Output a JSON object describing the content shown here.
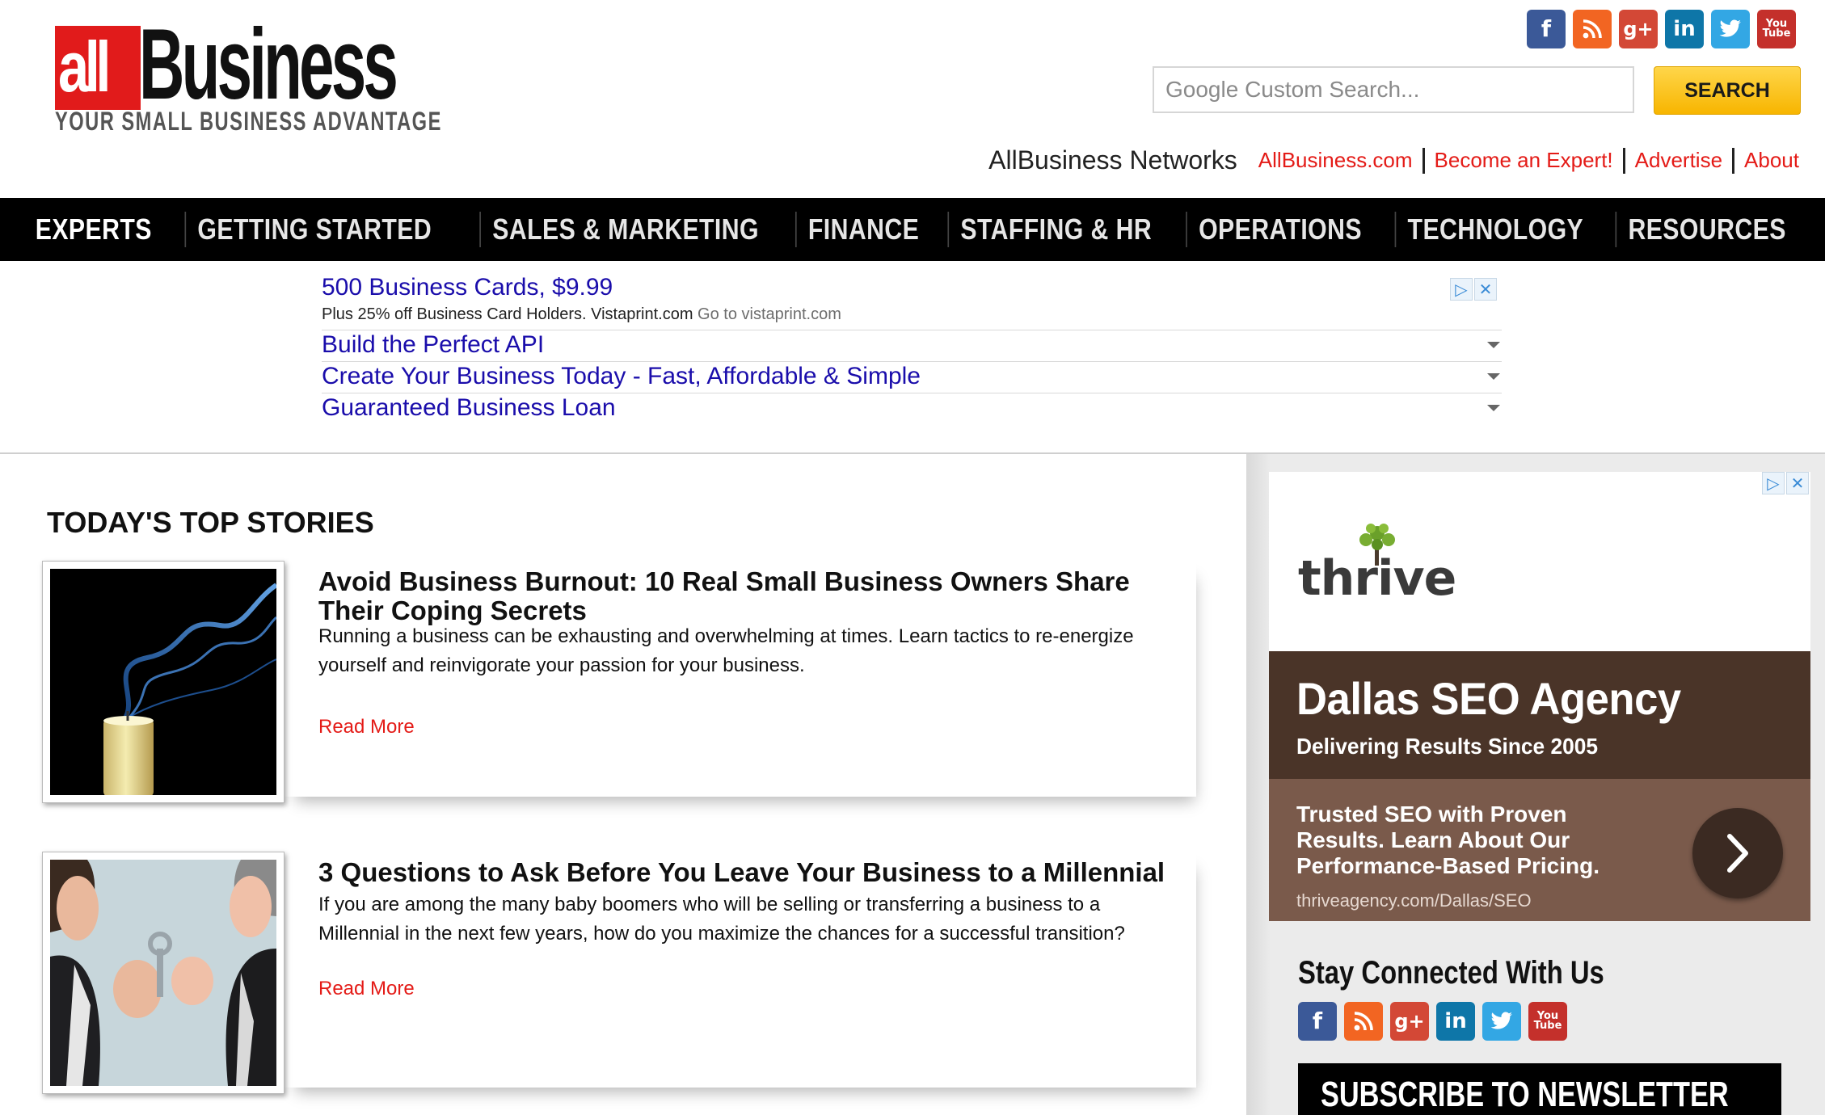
{
  "header": {
    "logo_all": "all",
    "logo_business": "Business",
    "logo_tagline": "YOUR SMALL BUSINESS ADVANTAGE",
    "search_placeholder": "Google Custom Search...",
    "search_button": "SEARCH",
    "networks_label": "AllBusiness Networks",
    "networks_links": [
      "AllBusiness.com",
      "Become an Expert!",
      "Advertise",
      "About"
    ],
    "social_icons": [
      "facebook-icon",
      "rss-icon",
      "google-plus-icon",
      "linkedin-icon",
      "twitter-icon",
      "youtube-icon"
    ],
    "youtube_text": "You\nTube"
  },
  "nav": {
    "items": [
      "EXPERTS",
      "GETTING STARTED",
      "SALES & MARKETING",
      "FINANCE",
      "STAFFING & HR",
      "OPERATIONS",
      "TECHNOLOGY",
      "RESOURCES"
    ]
  },
  "top_ad": {
    "main_title": "500 Business Cards, $9.99",
    "main_sub": "Plus 25% off Business Card Holders. Vistaprint.com",
    "main_go": "Go to vistaprint.com",
    "rows": [
      "Build the Perfect API",
      "Create Your Business Today - Fast, Affordable & Simple",
      "Guaranteed Business Loan"
    ]
  },
  "main": {
    "section_title": "TODAY'S TOP STORIES",
    "stories": [
      {
        "headline": "Avoid Business Burnout: 10 Real Small Business Owners Share Their Coping Secrets",
        "desc": "Running a business can be exhausting and overwhelming at times. Learn tactics to re-energize yourself and reinvigorate your passion for your business.",
        "more": "Read More"
      },
      {
        "headline": "3 Questions to Ask Before You Leave Your Business to a Millennial",
        "desc": "If you are among the many baby boomers who will be selling or transferring a business to a Millennial in the next few years, how do you maximize the chances for a successful transition?",
        "more": "Read More"
      }
    ]
  },
  "sidebar": {
    "ad": {
      "logo": "thrive",
      "headline": "Dallas SEO Agency",
      "subhead": "Delivering Results Since 2005",
      "body": "Trusted SEO with Proven Results. Learn About Our Performance-Based Pricing.",
      "url": "thriveagency.com/Dallas/SEO"
    },
    "stay_title": "Stay Connected With Us",
    "newsletter_title": "SUBSCRIBE TO NEWSLETTER"
  },
  "colors": {
    "accent_red": "#e41b17",
    "ad_link_blue": "#1a0dab",
    "nav_bg": "#000000",
    "search_yellow": "#f7b500",
    "thrive_brown": "#4a3428",
    "thrive_tan": "#7a5a4b"
  }
}
